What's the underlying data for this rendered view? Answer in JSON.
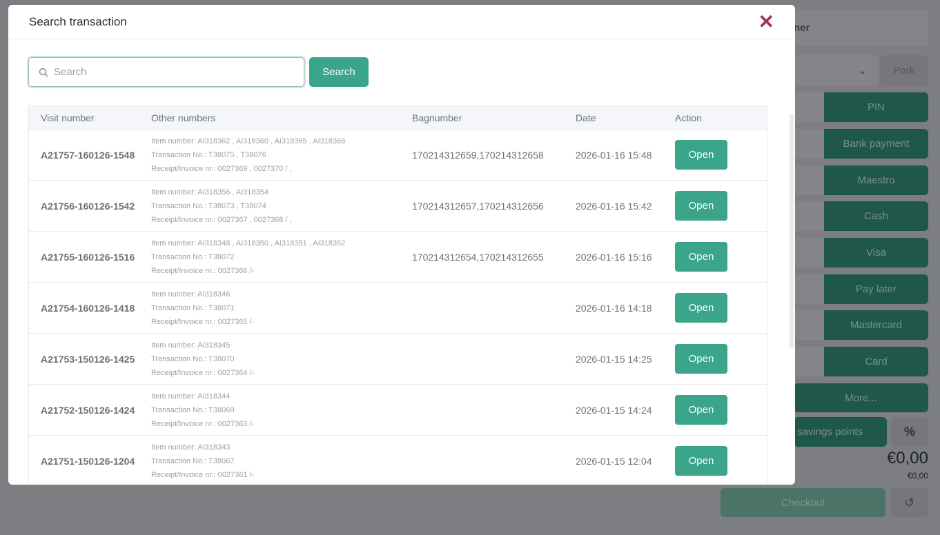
{
  "background": {
    "customer_label": "ner",
    "park_label": "Park",
    "payment_methods": [
      "PIN",
      "Bank payment",
      "Maestro",
      "Cash",
      "Visa",
      "Pay later",
      "Mastercard",
      "Card"
    ],
    "more_label": "More...",
    "savings_label": "savings points",
    "percent_label": "%",
    "total": "€0,00",
    "subtotal": "€0,00",
    "checkout_label": "Checkout"
  },
  "modal": {
    "title": "Search transaction",
    "search_placeholder": "Search",
    "search_value": "",
    "search_button": "Search",
    "columns": [
      "Visit number",
      "Other numbers",
      "Bagnumber",
      "Date",
      "Action"
    ],
    "rows": [
      {
        "visit": "A21757-160126-1548",
        "item": "Item number: AI318362 , AI318360 , AI318365 , AI318366",
        "trans": "Transaction No.: T38075 , T38076",
        "receipt": "Receipt/Invoice nr.: 0027369 , 0027370 / ,",
        "bag": "170214312659,170214312658",
        "date": "2026-01-16 15:48",
        "action": "Open"
      },
      {
        "visit": "A21756-160126-1542",
        "item": "Item number: AI318356 , AI318354",
        "trans": "Transaction No.: T38073 , T38074",
        "receipt": "Receipt/Invoice nr.: 0027367 , 0027368 / ,",
        "bag": "170214312657,170214312656",
        "date": "2026-01-16 15:42",
        "action": "Open"
      },
      {
        "visit": "A21755-160126-1516",
        "item": "Item number: AI318348 , AI318350 , AI318351 , AI318352",
        "trans": "Transaction No.: T38072",
        "receipt": "Receipt/Invoice nr.: 0027366 /-",
        "bag": "170214312654,170214312655",
        "date": "2026-01-16 15:16",
        "action": "Open"
      },
      {
        "visit": "A21754-160126-1418",
        "item": "Item number: AI318346",
        "trans": "Transaction No.: T38071",
        "receipt": "Receipt/Invoice nr.: 0027365 /-",
        "bag": "",
        "date": "2026-01-16 14:18",
        "action": "Open"
      },
      {
        "visit": "A21753-150126-1425",
        "item": "Item number: AI318345",
        "trans": "Transaction No.: T38070",
        "receipt": "Receipt/Invoice nr.: 0027364 /-",
        "bag": "",
        "date": "2026-01-15 14:25",
        "action": "Open"
      },
      {
        "visit": "A21752-150126-1424",
        "item": "Item number: AI318344",
        "trans": "Transaction No.: T38069",
        "receipt": "Receipt/Invoice nr.: 0027363 /-",
        "bag": "",
        "date": "2026-01-15 14:24",
        "action": "Open"
      },
      {
        "visit": "A21751-150126-1204",
        "item": "Item number: AI318343",
        "trans": "Transaction No.: T38067",
        "receipt": "Receipt/Invoice nr.: 0027361 /-",
        "bag": "",
        "date": "2026-01-15 12:04",
        "action": "Open"
      }
    ]
  }
}
